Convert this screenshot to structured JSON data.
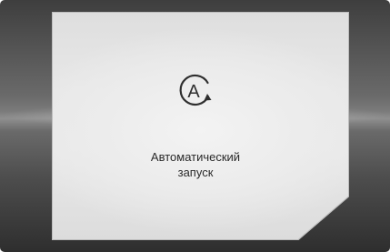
{
  "screen": {
    "icon": "auto-start-icon",
    "icon_letter": "A",
    "message_line1": "Автоматический",
    "message_line2": "запуск"
  }
}
